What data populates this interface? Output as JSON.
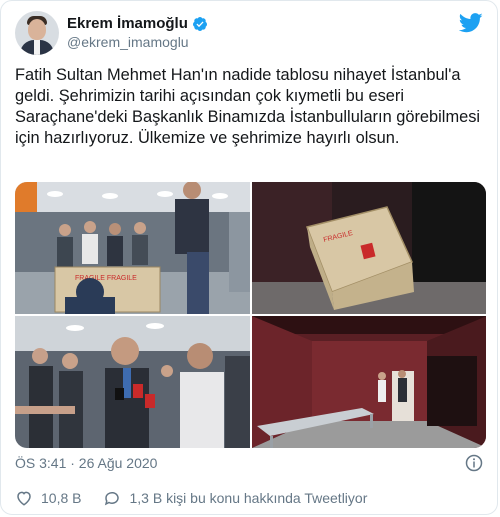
{
  "user": {
    "display_name": "Ekrem İmamoğlu",
    "handle": "@ekrem_imamoglu"
  },
  "tweet": {
    "text": "Fatih Sultan Mehmet Han'ın nadide tablosu nihayet İstanbul'a geldi. Şehrimizin tarihi açısından çok kıymetli bu eseri Saraçhane'deki Başkanlık Binamızda İstanbulluların görebilmesi için hazırlıyoruz. Ülkemize ve şehrimize hayırlı olsun.",
    "timestamp": "ÖS 3:41 · 26 Ağu 2020",
    "likes": "10,8 B",
    "talking": "1,3 B kişi bu konu hakkında Tweetliyor"
  },
  "media": {
    "photo1": {
      "crate_text": "FRAGILE FRAGILE"
    },
    "photo2": {
      "crate_text": "FRAGILE"
    }
  },
  "icons": {
    "verified": "verified-badge-icon",
    "logo": "twitter-bird-icon",
    "info": "info-icon",
    "like": "heart-icon",
    "talk": "speech-bubble-icon"
  },
  "colors": {
    "brand": "#1da1f2",
    "text": "#14171a",
    "muted": "#657786",
    "crate": "#d8c7a5",
    "crate_label": "#c92a2a"
  }
}
